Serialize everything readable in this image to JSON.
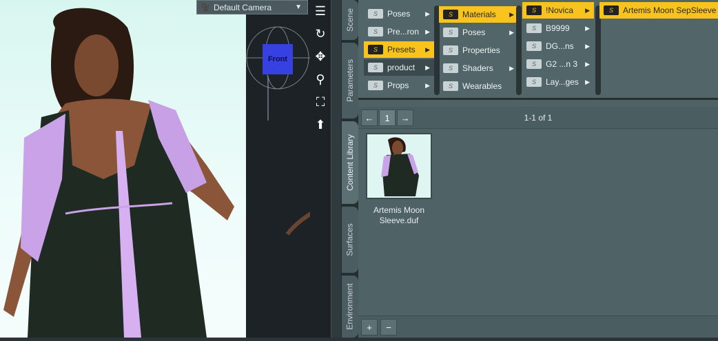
{
  "viewport": {
    "camera_label": "Default Camera",
    "cube_label": "Front"
  },
  "tabs": [
    {
      "label": "Scene"
    },
    {
      "label": "Parameters"
    },
    {
      "label": "Content Library",
      "active": true
    },
    {
      "label": "Surfaces"
    },
    {
      "label": "Environment"
    }
  ],
  "browser": {
    "col1": [
      {
        "label": "Poses"
      },
      {
        "label": "Pre...ron"
      },
      {
        "label": "Presets",
        "selected": true
      },
      {
        "label": "product"
      },
      {
        "label": "Props"
      }
    ],
    "col2": [
      {
        "label": "Materials",
        "selected": true
      },
      {
        "label": "Poses"
      },
      {
        "label": "Properties"
      },
      {
        "label": "Shaders"
      },
      {
        "label": "Wearables"
      }
    ],
    "col3": [
      {
        "label": "!Novica",
        "selected": true
      },
      {
        "label": "B9999"
      },
      {
        "label": "DG...ns"
      },
      {
        "label": "G2 ...n 3"
      },
      {
        "label": "Lay...ges"
      }
    ],
    "col4": [
      {
        "label": "Artemis Moon SepSleeve",
        "selected": true
      }
    ]
  },
  "pager": {
    "page": "1",
    "count": "1-1 of 1"
  },
  "asset": {
    "line1": "Artemis Moon",
    "line2": "Sleeve.duf"
  },
  "bottombar": {
    "add": "+",
    "remove": "−"
  },
  "colors": {
    "selection": "#f7c31c",
    "panel": "#4f6266",
    "viewport_bg": "#e2f8f4"
  }
}
